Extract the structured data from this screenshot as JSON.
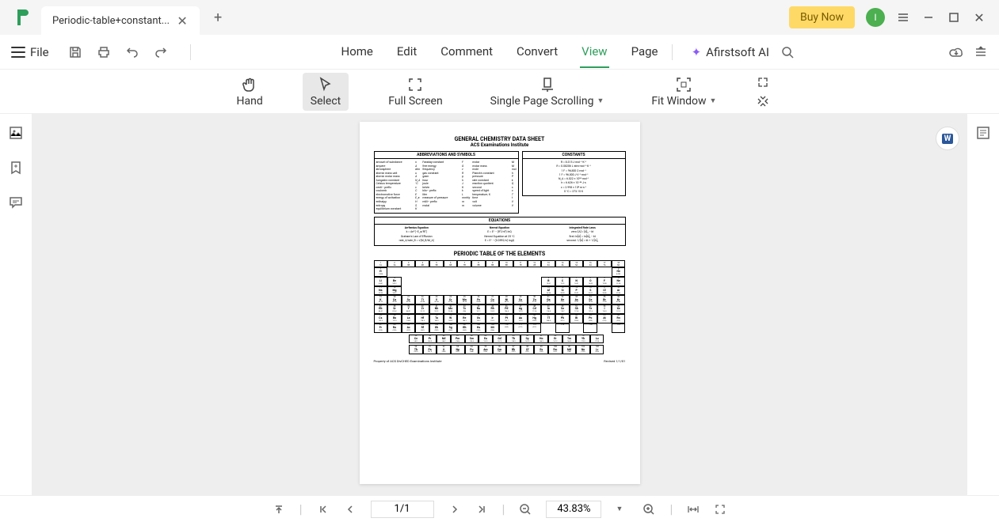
{
  "titlebar": {
    "tab_title": "Periodic-table+constant...",
    "buy_now": "Buy Now",
    "avatar_initial": "I"
  },
  "menubar": {
    "file": "File",
    "tabs": [
      "Home",
      "Edit",
      "Comment",
      "Convert",
      "View",
      "Page"
    ],
    "active_tab": "View",
    "ai_label": "Afirstsoft AI"
  },
  "ribbon": {
    "hand": "Hand",
    "select": "Select",
    "full_screen": "Full Screen",
    "single_page": "Single Page Scrolling",
    "fit_window": "Fit Window"
  },
  "bottombar": {
    "page": "1/1",
    "zoom": "43.83%"
  },
  "doc": {
    "title": "GENERAL CHEMISTRY DATA SHEET",
    "subtitle": "ACS Examinations Institute",
    "abbr_head": "ABBREVIATIONS AND SYMBOLS",
    "const_head": "CONSTANTS",
    "eq_head": "EQUATIONS",
    "pt_title": "PERIODIC TABLE OF THE ELEMENTS",
    "property": "Property of ACS DivCHED Examinations Institute",
    "revised": "Revised 1/1/01",
    "abbreviations": [
      [
        "amount of substance",
        "n",
        "Faraday constant",
        "F",
        "molar",
        "M"
      ],
      [
        "ampere",
        "A",
        "free energy",
        "G",
        "molar mass",
        "M"
      ],
      [
        "atmosphere",
        "atm",
        "frequency",
        "ν",
        "mole",
        "mol"
      ],
      [
        "atomic mass unit",
        "u",
        "gas constant",
        "R",
        "Planck's constant",
        "h"
      ],
      [
        "atomic molar mass",
        "A",
        "gram",
        "g",
        "pressure",
        "P"
      ],
      [
        "Avogadro constant",
        "N_A",
        "hour",
        "h",
        "rate constant",
        "k"
      ],
      [
        "Celsius temperature",
        "°C",
        "joule",
        "J",
        "reaction quotient",
        "Q"
      ],
      [
        "centi– prefix",
        "c",
        "kelvin",
        "K",
        "second",
        "s"
      ],
      [
        "coulomb",
        "C",
        "kilo– prefix",
        "k",
        "speed of light",
        "c"
      ],
      [
        "electromotive force",
        "E",
        "liter",
        "L",
        "temperature, K",
        "T"
      ],
      [
        "energy of activation",
        "E_a",
        "measure of pressure",
        "mmHg",
        "time",
        "t"
      ],
      [
        "enthalpy",
        "H",
        "milli– prefix",
        "m",
        "volt",
        "V"
      ],
      [
        "entropy",
        "S",
        "molal",
        "m",
        "volume",
        "V"
      ],
      [
        "equilibrium constant",
        "K",
        "",
        "",
        "",
        ""
      ]
    ],
    "constants": [
      "R = 8.315 J·mol⁻¹·K⁻¹",
      "R = 0.08206 L·atm·mol⁻¹·K⁻¹",
      "1 F = 96,500 C·mol⁻¹",
      "1 F = 96,500 J·V⁻¹·mol⁻¹",
      "N_A = 6.022 × 10²³ mol⁻¹",
      "h = 6.626 × 10⁻³⁴ J·s",
      "c = 2.998 × 10⁸ m·s⁻¹",
      "0 °C = 273.15 K"
    ],
    "equations": {
      "col1_head": "Arrhenius Equation",
      "col1": [
        "k = Ae^(−E_a/RT)",
        "Graham's Law of Effusion",
        "rate_A/rate_B = √(M_B/M_A)"
      ],
      "col2_head": "Nernst Equation",
      "col2": [
        "E = E° − (RT/nF) lnQ",
        "Nernst Equation at 25 °C",
        "E = E° − (0.0592/n) logQ"
      ],
      "col3_head": "Integrated Rate Laws",
      "col3": [
        "zero: [A] = [A]₀ − kt",
        "first: ln[A] = ln[A]₀ − kt",
        "second: 1/[A] = kt + 1/[A]₀"
      ]
    },
    "elements": [
      {
        "n": "1",
        "s": "H",
        "m": "1.008",
        "g": 1,
        "p": 1
      },
      {
        "n": "2",
        "s": "He",
        "m": "4.003",
        "g": 18,
        "p": 1
      },
      {
        "n": "3",
        "s": "Li",
        "m": "6.941",
        "g": 1,
        "p": 2
      },
      {
        "n": "4",
        "s": "Be",
        "m": "9.012",
        "g": 2,
        "p": 2
      },
      {
        "n": "5",
        "s": "B",
        "m": "10.81",
        "g": 13,
        "p": 2
      },
      {
        "n": "6",
        "s": "C",
        "m": "12.01",
        "g": 14,
        "p": 2
      },
      {
        "n": "7",
        "s": "N",
        "m": "14.01",
        "g": 15,
        "p": 2
      },
      {
        "n": "8",
        "s": "O",
        "m": "16.00",
        "g": 16,
        "p": 2
      },
      {
        "n": "9",
        "s": "F",
        "m": "19.00",
        "g": 17,
        "p": 2
      },
      {
        "n": "10",
        "s": "Ne",
        "m": "20.18",
        "g": 18,
        "p": 2
      },
      {
        "n": "11",
        "s": "Na",
        "m": "22.99",
        "g": 1,
        "p": 3
      },
      {
        "n": "12",
        "s": "Mg",
        "m": "24.31",
        "g": 2,
        "p": 3
      },
      {
        "n": "13",
        "s": "Al",
        "m": "26.98",
        "g": 13,
        "p": 3
      },
      {
        "n": "14",
        "s": "Si",
        "m": "28.09",
        "g": 14,
        "p": 3
      },
      {
        "n": "15",
        "s": "P",
        "m": "30.97",
        "g": 15,
        "p": 3
      },
      {
        "n": "16",
        "s": "S",
        "m": "32.07",
        "g": 16,
        "p": 3
      },
      {
        "n": "17",
        "s": "Cl",
        "m": "35.45",
        "g": 17,
        "p": 3
      },
      {
        "n": "18",
        "s": "Ar",
        "m": "39.95",
        "g": 18,
        "p": 3
      },
      {
        "n": "19",
        "s": "K",
        "m": "39.10",
        "g": 1,
        "p": 4
      },
      {
        "n": "20",
        "s": "Ca",
        "m": "40.08",
        "g": 2,
        "p": 4
      },
      {
        "n": "21",
        "s": "Sc",
        "m": "44.96",
        "g": 3,
        "p": 4
      },
      {
        "n": "22",
        "s": "Ti",
        "m": "47.88",
        "g": 4,
        "p": 4
      },
      {
        "n": "23",
        "s": "V",
        "m": "50.94",
        "g": 5,
        "p": 4
      },
      {
        "n": "24",
        "s": "Cr",
        "m": "52.00",
        "g": 6,
        "p": 4
      },
      {
        "n": "25",
        "s": "Mn",
        "m": "54.94",
        "g": 7,
        "p": 4
      },
      {
        "n": "26",
        "s": "Fe",
        "m": "55.85",
        "g": 8,
        "p": 4
      },
      {
        "n": "27",
        "s": "Co",
        "m": "58.93",
        "g": 9,
        "p": 4
      },
      {
        "n": "28",
        "s": "Ni",
        "m": "58.69",
        "g": 10,
        "p": 4
      },
      {
        "n": "29",
        "s": "Cu",
        "m": "63.55",
        "g": 11,
        "p": 4
      },
      {
        "n": "30",
        "s": "Zn",
        "m": "65.39",
        "g": 12,
        "p": 4
      },
      {
        "n": "31",
        "s": "Ga",
        "m": "69.72",
        "g": 13,
        "p": 4
      },
      {
        "n": "32",
        "s": "Ge",
        "m": "72.61",
        "g": 14,
        "p": 4
      },
      {
        "n": "33",
        "s": "As",
        "m": "74.92",
        "g": 15,
        "p": 4
      },
      {
        "n": "34",
        "s": "Se",
        "m": "78.96",
        "g": 16,
        "p": 4
      },
      {
        "n": "35",
        "s": "Br",
        "m": "79.90",
        "g": 17,
        "p": 4
      },
      {
        "n": "36",
        "s": "Kr",
        "m": "83.80",
        "g": 18,
        "p": 4
      },
      {
        "n": "37",
        "s": "Rb",
        "m": "85.47",
        "g": 1,
        "p": 5
      },
      {
        "n": "38",
        "s": "Sr",
        "m": "87.62",
        "g": 2,
        "p": 5
      },
      {
        "n": "39",
        "s": "Y",
        "m": "88.91",
        "g": 3,
        "p": 5
      },
      {
        "n": "40",
        "s": "Zr",
        "m": "91.22",
        "g": 4,
        "p": 5
      },
      {
        "n": "41",
        "s": "Nb",
        "m": "92.91",
        "g": 5,
        "p": 5
      },
      {
        "n": "42",
        "s": "Mo",
        "m": "95.94",
        "g": 6,
        "p": 5
      },
      {
        "n": "43",
        "s": "Tc",
        "m": "(98)",
        "g": 7,
        "p": 5
      },
      {
        "n": "44",
        "s": "Ru",
        "m": "101.1",
        "g": 8,
        "p": 5
      },
      {
        "n": "45",
        "s": "Rh",
        "m": "102.9",
        "g": 9,
        "p": 5
      },
      {
        "n": "46",
        "s": "Pd",
        "m": "106.4",
        "g": 10,
        "p": 5
      },
      {
        "n": "47",
        "s": "Ag",
        "m": "107.9",
        "g": 11,
        "p": 5
      },
      {
        "n": "48",
        "s": "Cd",
        "m": "112.4",
        "g": 12,
        "p": 5
      },
      {
        "n": "49",
        "s": "In",
        "m": "114.8",
        "g": 13,
        "p": 5
      },
      {
        "n": "50",
        "s": "Sn",
        "m": "118.7",
        "g": 14,
        "p": 5
      },
      {
        "n": "51",
        "s": "Sb",
        "m": "121.8",
        "g": 15,
        "p": 5
      },
      {
        "n": "52",
        "s": "Te",
        "m": "127.6",
        "g": 16,
        "p": 5
      },
      {
        "n": "53",
        "s": "I",
        "m": "126.9",
        "g": 17,
        "p": 5
      },
      {
        "n": "54",
        "s": "Xe",
        "m": "131.3",
        "g": 18,
        "p": 5
      },
      {
        "n": "55",
        "s": "Cs",
        "m": "132.9",
        "g": 1,
        "p": 6
      },
      {
        "n": "56",
        "s": "Ba",
        "m": "137.3",
        "g": 2,
        "p": 6
      },
      {
        "n": "57",
        "s": "La",
        "m": "138.9",
        "g": 3,
        "p": 6
      },
      {
        "n": "72",
        "s": "Hf",
        "m": "178.5",
        "g": 4,
        "p": 6
      },
      {
        "n": "73",
        "s": "Ta",
        "m": "180.9",
        "g": 5,
        "p": 6
      },
      {
        "n": "74",
        "s": "W",
        "m": "183.9",
        "g": 6,
        "p": 6
      },
      {
        "n": "75",
        "s": "Re",
        "m": "186.2",
        "g": 7,
        "p": 6
      },
      {
        "n": "76",
        "s": "Os",
        "m": "190.2",
        "g": 8,
        "p": 6
      },
      {
        "n": "77",
        "s": "Ir",
        "m": "192.2",
        "g": 9,
        "p": 6
      },
      {
        "n": "78",
        "s": "Pt",
        "m": "195.1",
        "g": 10,
        "p": 6
      },
      {
        "n": "79",
        "s": "Au",
        "m": "197.0",
        "g": 11,
        "p": 6
      },
      {
        "n": "80",
        "s": "Hg",
        "m": "200.6",
        "g": 12,
        "p": 6
      },
      {
        "n": "81",
        "s": "Tl",
        "m": "204.4",
        "g": 13,
        "p": 6
      },
      {
        "n": "82",
        "s": "Pb",
        "m": "207.2",
        "g": 14,
        "p": 6
      },
      {
        "n": "83",
        "s": "Bi",
        "m": "209.0",
        "g": 15,
        "p": 6
      },
      {
        "n": "84",
        "s": "Po",
        "m": "(209)",
        "g": 16,
        "p": 6
      },
      {
        "n": "85",
        "s": "At",
        "m": "(210)",
        "g": 17,
        "p": 6
      },
      {
        "n": "86",
        "s": "Rn",
        "m": "(222)",
        "g": 18,
        "p": 6
      },
      {
        "n": "87",
        "s": "Fr",
        "m": "(223)",
        "g": 1,
        "p": 7
      },
      {
        "n": "88",
        "s": "Ra",
        "m": "(226)",
        "g": 2,
        "p": 7
      },
      {
        "n": "89",
        "s": "Ac",
        "m": "(227)",
        "g": 3,
        "p": 7
      },
      {
        "n": "104",
        "s": "Rf",
        "m": "(261)",
        "g": 4,
        "p": 7
      },
      {
        "n": "105",
        "s": "Db",
        "m": "(262)",
        "g": 5,
        "p": 7
      },
      {
        "n": "106",
        "s": "Sg",
        "m": "(263)",
        "g": 6,
        "p": 7
      },
      {
        "n": "107",
        "s": "Bh",
        "m": "(262)",
        "g": 7,
        "p": 7
      },
      {
        "n": "108",
        "s": "Hs",
        "m": "(265)",
        "g": 8,
        "p": 7
      },
      {
        "n": "109",
        "s": "Mt",
        "m": "(266)",
        "g": 9,
        "p": 7
      },
      {
        "n": "110",
        "s": "",
        "m": "(269)",
        "g": 10,
        "p": 7
      },
      {
        "n": "111",
        "s": "",
        "m": "(272)",
        "g": 11,
        "p": 7
      },
      {
        "n": "112",
        "s": "",
        "m": "(277)",
        "g": 12,
        "p": 7
      },
      {
        "n": "114",
        "s": "",
        "m": "",
        "g": 14,
        "p": 7
      },
      {
        "n": "116",
        "s": "",
        "m": "",
        "g": 16,
        "p": 7
      },
      {
        "n": "118",
        "s": "",
        "m": "",
        "g": 18,
        "p": 7
      }
    ],
    "lanthanides": [
      {
        "n": "58",
        "s": "Ce",
        "m": "140.1"
      },
      {
        "n": "59",
        "s": "Pr",
        "m": "140.9"
      },
      {
        "n": "60",
        "s": "Nd",
        "m": "144.2"
      },
      {
        "n": "61",
        "s": "Pm",
        "m": "(145)"
      },
      {
        "n": "62",
        "s": "Sm",
        "m": "150.4"
      },
      {
        "n": "63",
        "s": "Eu",
        "m": "152.0"
      },
      {
        "n": "64",
        "s": "Gd",
        "m": "157.3"
      },
      {
        "n": "65",
        "s": "Tb",
        "m": "158.9"
      },
      {
        "n": "66",
        "s": "Dy",
        "m": "162.5"
      },
      {
        "n": "67",
        "s": "Ho",
        "m": "164.9"
      },
      {
        "n": "68",
        "s": "Er",
        "m": "167.3"
      },
      {
        "n": "69",
        "s": "Tm",
        "m": "168.9"
      },
      {
        "n": "70",
        "s": "Yb",
        "m": "173.0"
      },
      {
        "n": "71",
        "s": "Lu",
        "m": "175.0"
      }
    ],
    "actinides": [
      {
        "n": "90",
        "s": "Th",
        "m": "232.0"
      },
      {
        "n": "91",
        "s": "Pa",
        "m": "231.0"
      },
      {
        "n": "92",
        "s": "U",
        "m": "238.0"
      },
      {
        "n": "93",
        "s": "Np",
        "m": "(237)"
      },
      {
        "n": "94",
        "s": "Pu",
        "m": "(244)"
      },
      {
        "n": "95",
        "s": "Am",
        "m": "(243)"
      },
      {
        "n": "96",
        "s": "Cm",
        "m": "(247)"
      },
      {
        "n": "97",
        "s": "Bk",
        "m": "(247)"
      },
      {
        "n": "98",
        "s": "Cf",
        "m": "(251)"
      },
      {
        "n": "99",
        "s": "Es",
        "m": "(252)"
      },
      {
        "n": "100",
        "s": "Fm",
        "m": "(257)"
      },
      {
        "n": "101",
        "s": "Md",
        "m": "(258)"
      },
      {
        "n": "102",
        "s": "No",
        "m": "(259)"
      },
      {
        "n": "103",
        "s": "Lr",
        "m": "(260)"
      }
    ],
    "groups_top": [
      "1",
      "2",
      "3",
      "4",
      "5",
      "6",
      "7",
      "8",
      "9",
      "10",
      "11",
      "12",
      "13",
      "14",
      "15",
      "16",
      "17",
      "18"
    ],
    "groups_old": [
      "1A",
      "2A",
      "3B",
      "4B",
      "5B",
      "6B",
      "7B",
      "8B",
      "8B",
      "8B",
      "1B",
      "2B",
      "3A",
      "4A",
      "5A",
      "6A",
      "7A",
      "8A"
    ]
  }
}
